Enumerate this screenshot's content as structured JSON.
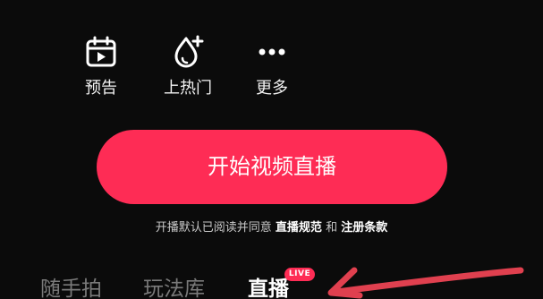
{
  "tools": {
    "preview": {
      "label": "预告",
      "icon": "calendar-play-icon"
    },
    "hot": {
      "label": "上热门",
      "icon": "flame-plus-icon"
    },
    "more": {
      "label": "更多",
      "icon": "more-dots-icon"
    }
  },
  "start_button": {
    "label": "开始视频直播"
  },
  "agreement": {
    "prefix": "开播默认已阅读并同意",
    "link1": "直播规范",
    "connector": "和",
    "link2": "注册条款"
  },
  "tabs": [
    {
      "label": "随手拍"
    },
    {
      "label": "玩法库"
    },
    {
      "label": "直播"
    }
  ],
  "live_badge": "LIVE",
  "colors": {
    "accent": "#fe2c55",
    "background": "#0b0b0b",
    "annotation_arrow": "#e0404f"
  }
}
